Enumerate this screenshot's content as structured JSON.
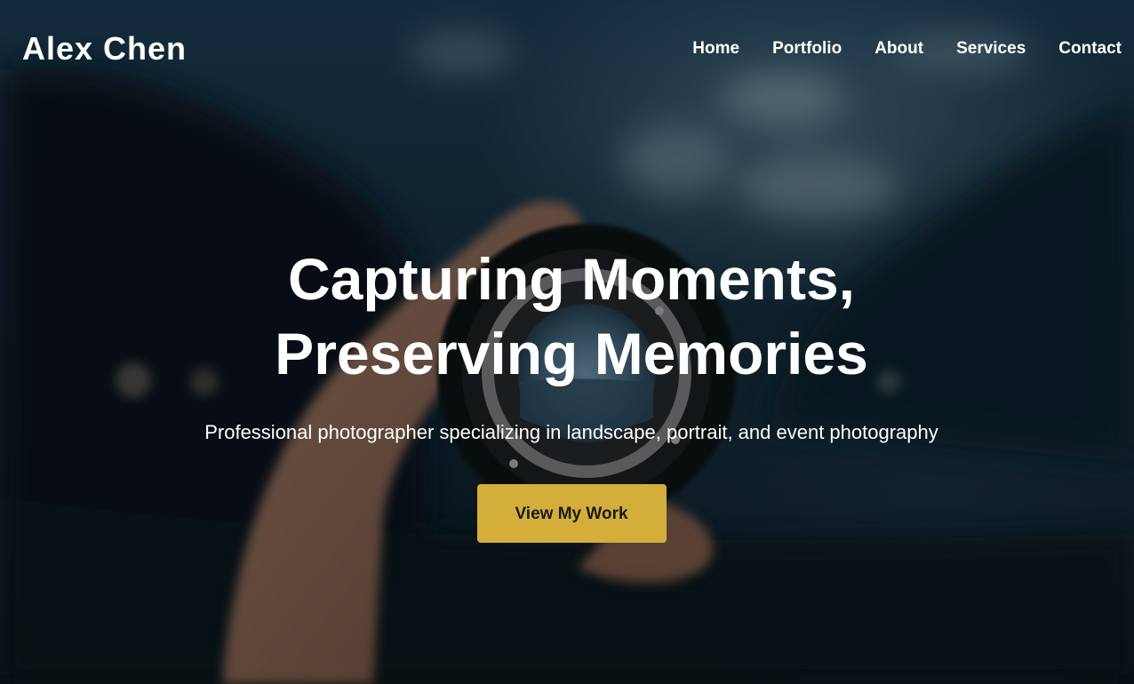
{
  "header": {
    "logo": "Alex Chen",
    "nav": [
      {
        "label": "Home"
      },
      {
        "label": "Portfolio"
      },
      {
        "label": "About"
      },
      {
        "label": "Services"
      },
      {
        "label": "Contact"
      }
    ]
  },
  "hero": {
    "title_line1": "Capturing Moments,",
    "title_line2": "Preserving Memories",
    "subtitle": "Professional photographer specializing in landscape, portrait, and event photography",
    "cta_label": "View My Work"
  },
  "colors": {
    "accent": "#d4ae3a",
    "text": "#ffffff",
    "cta_text": "#1a1a1a"
  }
}
